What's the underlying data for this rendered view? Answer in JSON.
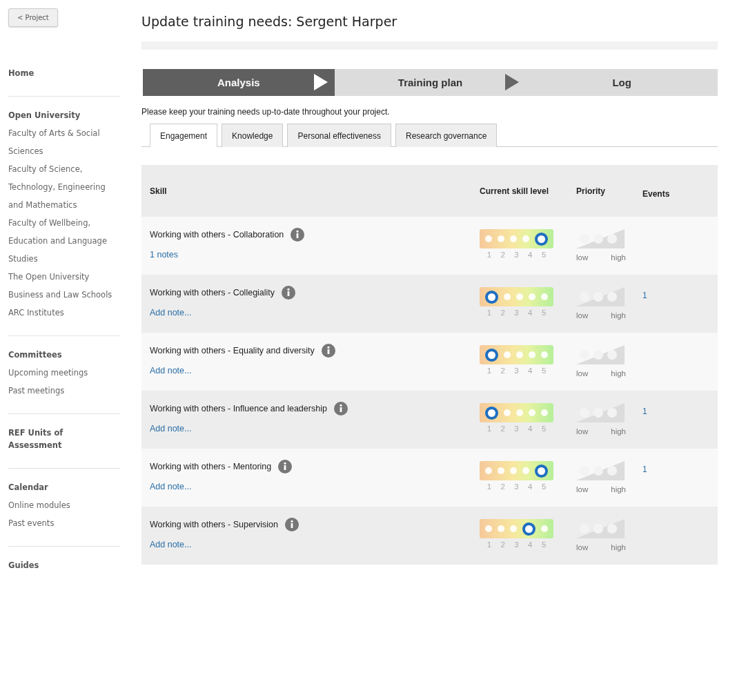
{
  "back_button": {
    "label": "< Project"
  },
  "title": "Update training needs: Sergent Harper",
  "sidebar": {
    "sections": [
      {
        "heading": "Home"
      },
      {
        "heading": "Open University",
        "items": [
          "Faculty of Arts & Social Sciences",
          "Faculty of Science, Technology, Engineering and Mathematics",
          "Faculty of Wellbeing, Education and Language Studies",
          "The Open University Business and Law Schools",
          "ARC Institutes"
        ]
      },
      {
        "heading": "Committees",
        "items": [
          "Upcoming meetings",
          "Past meetings"
        ]
      },
      {
        "heading": "REF Units of Assessment"
      },
      {
        "heading": "Calendar",
        "items": [
          "Online modules",
          "Past events"
        ]
      },
      {
        "heading": "Guides"
      }
    ]
  },
  "steps": [
    {
      "label": "Analysis",
      "selected": true
    },
    {
      "label": "Training plan",
      "selected": false
    },
    {
      "label": "Log",
      "selected": false
    }
  ],
  "intro": "Please keep your training needs up-to-date throughout your project.",
  "tabs": [
    {
      "label": "Engagement",
      "selected": true
    },
    {
      "label": "Knowledge",
      "selected": false
    },
    {
      "label": "Personal effectiveness",
      "selected": false
    },
    {
      "label": "Research governance",
      "selected": false
    }
  ],
  "table": {
    "columns": [
      "Skill",
      "Current skill level",
      "Priority",
      "Events"
    ],
    "rows": [
      {
        "skill": "Working with others - Collaboration",
        "note": "1 notes",
        "priority_labels": [
          "low",
          "high"
        ],
        "levels": [
          {
            "label": "1",
            "selected": false
          },
          {
            "label": "2",
            "selected": false
          },
          {
            "label": "3",
            "selected": false
          },
          {
            "label": "4",
            "selected": false
          },
          {
            "label": "5",
            "selected": true
          }
        ]
      },
      {
        "skill": "Working with others - Collegiality",
        "note": "Add note...",
        "priority_labels": [
          "low",
          "high"
        ],
        "events": "1",
        "levels": [
          {
            "label": "1",
            "selected": true
          },
          {
            "label": "2",
            "selected": false
          },
          {
            "label": "3",
            "selected": false
          },
          {
            "label": "4",
            "selected": false
          },
          {
            "label": "5",
            "selected": false
          }
        ]
      },
      {
        "skill": "Working with others - Equality and diversity",
        "note": "Add note...",
        "priority_labels": [
          "low",
          "high"
        ],
        "levels": [
          {
            "label": "1",
            "selected": true
          },
          {
            "label": "2",
            "selected": false
          },
          {
            "label": "3",
            "selected": false
          },
          {
            "label": "4",
            "selected": false
          },
          {
            "label": "5",
            "selected": false
          }
        ]
      },
      {
        "skill": "Working with others - Influence and leadership",
        "note": "Add note...",
        "priority_labels": [
          "low",
          "high"
        ],
        "events": "1",
        "levels": [
          {
            "label": "1",
            "selected": true
          },
          {
            "label": "2",
            "selected": false
          },
          {
            "label": "3",
            "selected": false
          },
          {
            "label": "4",
            "selected": false
          },
          {
            "label": "5",
            "selected": false
          }
        ]
      },
      {
        "skill": "Working with others - Mentoring",
        "note": "Add note...",
        "priority_labels": [
          "low",
          "high"
        ],
        "events": "1",
        "levels": [
          {
            "label": "1",
            "selected": false
          },
          {
            "label": "2",
            "selected": false
          },
          {
            "label": "3",
            "selected": false
          },
          {
            "label": "4",
            "selected": false
          },
          {
            "label": "5",
            "selected": true
          }
        ]
      },
      {
        "skill": "Working with others - Supervision",
        "note": "Add note...",
        "priority_labels": [
          "low",
          "high"
        ],
        "levels": [
          {
            "label": "1",
            "selected": false
          },
          {
            "label": "2",
            "selected": false
          },
          {
            "label": "3",
            "selected": false
          },
          {
            "label": "4",
            "selected": true
          },
          {
            "label": "5",
            "selected": false
          }
        ]
      }
    ]
  }
}
